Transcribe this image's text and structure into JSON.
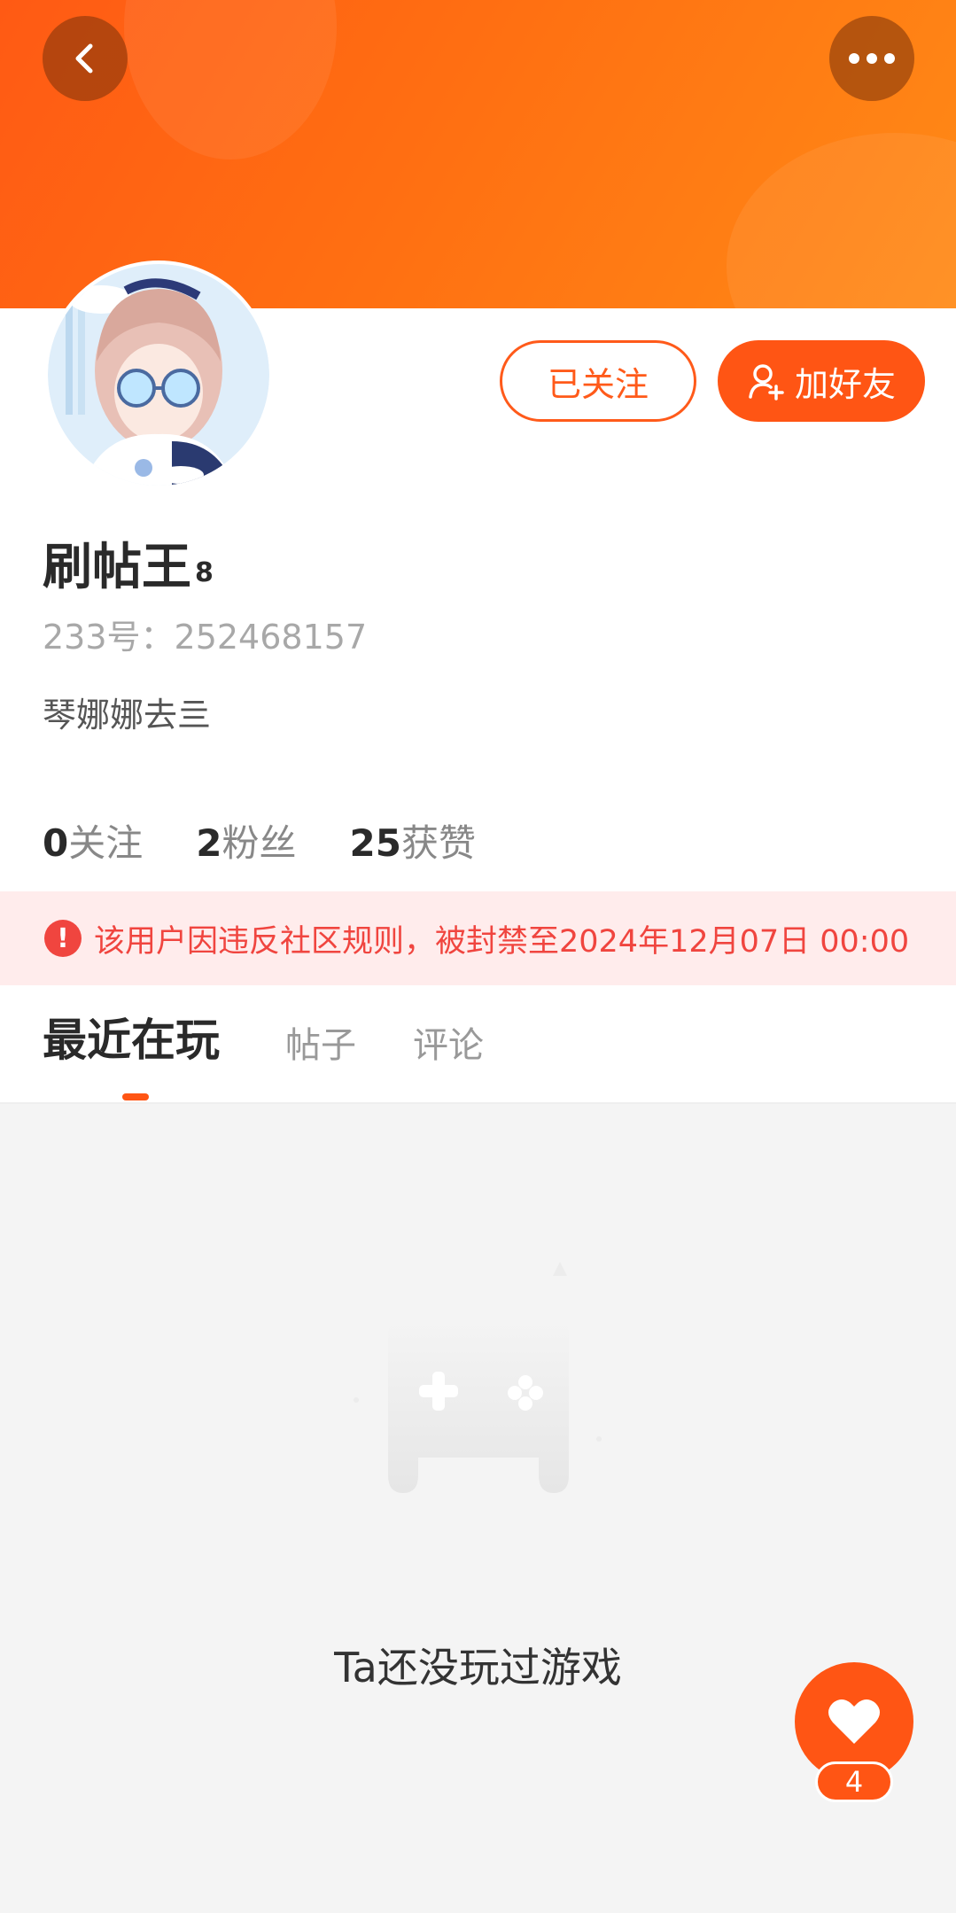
{
  "header": {
    "back_icon": "chevron-left-icon",
    "more_icon": "more-dots-icon"
  },
  "profile": {
    "follow_label": "已关注",
    "add_friend_label": "加好友",
    "add_friend_icon": "add-user-icon",
    "username": "刷帖王",
    "level": "8",
    "uid_text": "233号：252468157",
    "bio": "琴娜娜去亖"
  },
  "stats": [
    {
      "num": "0",
      "label": "关注"
    },
    {
      "num": "2",
      "label": "粉丝"
    },
    {
      "num": "25",
      "label": "获赞"
    }
  ],
  "ban_notice": {
    "icon": "alert-icon",
    "icon_glyph": "!",
    "text": "该用户因违反社区规则，被封禁至2024年12月07日 00:00",
    "color": "#f0453f"
  },
  "tabs": [
    {
      "label": "最近在玩",
      "active": true
    },
    {
      "label": "帖子",
      "active": false
    },
    {
      "label": "评论",
      "active": false
    }
  ],
  "empty_state": {
    "icon": "gamepad-icon",
    "text": "Ta还没玩过游戏"
  },
  "like_fab": {
    "icon": "heart-icon",
    "count": "4"
  },
  "colors": {
    "accent": "#ff5514",
    "banner_start": "#ff5a14",
    "banner_end": "#ff8a16"
  }
}
